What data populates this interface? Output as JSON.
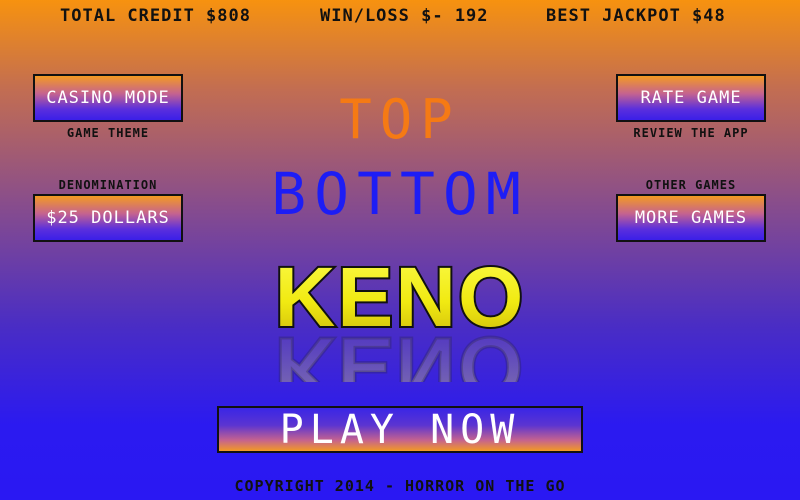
{
  "stats": {
    "total_credit": "TOTAL CREDIT $808",
    "win_loss": "WIN/LOSS $- 192",
    "best_jackpot": "BEST JACKPOT $48"
  },
  "left_panel": {
    "casino_button": "CASINO MODE",
    "theme_caption": "GAME THEME",
    "denom_caption": "DENOMINATION",
    "denom_button": "$25 DOLLARS"
  },
  "right_panel": {
    "rate_button": "RATE GAME",
    "review_caption": "REVIEW THE APP",
    "other_caption": "OTHER GAMES",
    "more_button": "MORE GAMES"
  },
  "title": {
    "line1": "TOP",
    "line2": "BOTTOM",
    "logo": "KENO"
  },
  "play_button": "PLAY NOW",
  "copyright": "COPYRIGHT 2014 - HORROR ON THE GO",
  "colors": {
    "top_text": "#f57a14",
    "bottom_text": "#1d1df5",
    "logo_fill_top": "#f4f21a",
    "logo_fill_bottom": "#d8c70e"
  }
}
